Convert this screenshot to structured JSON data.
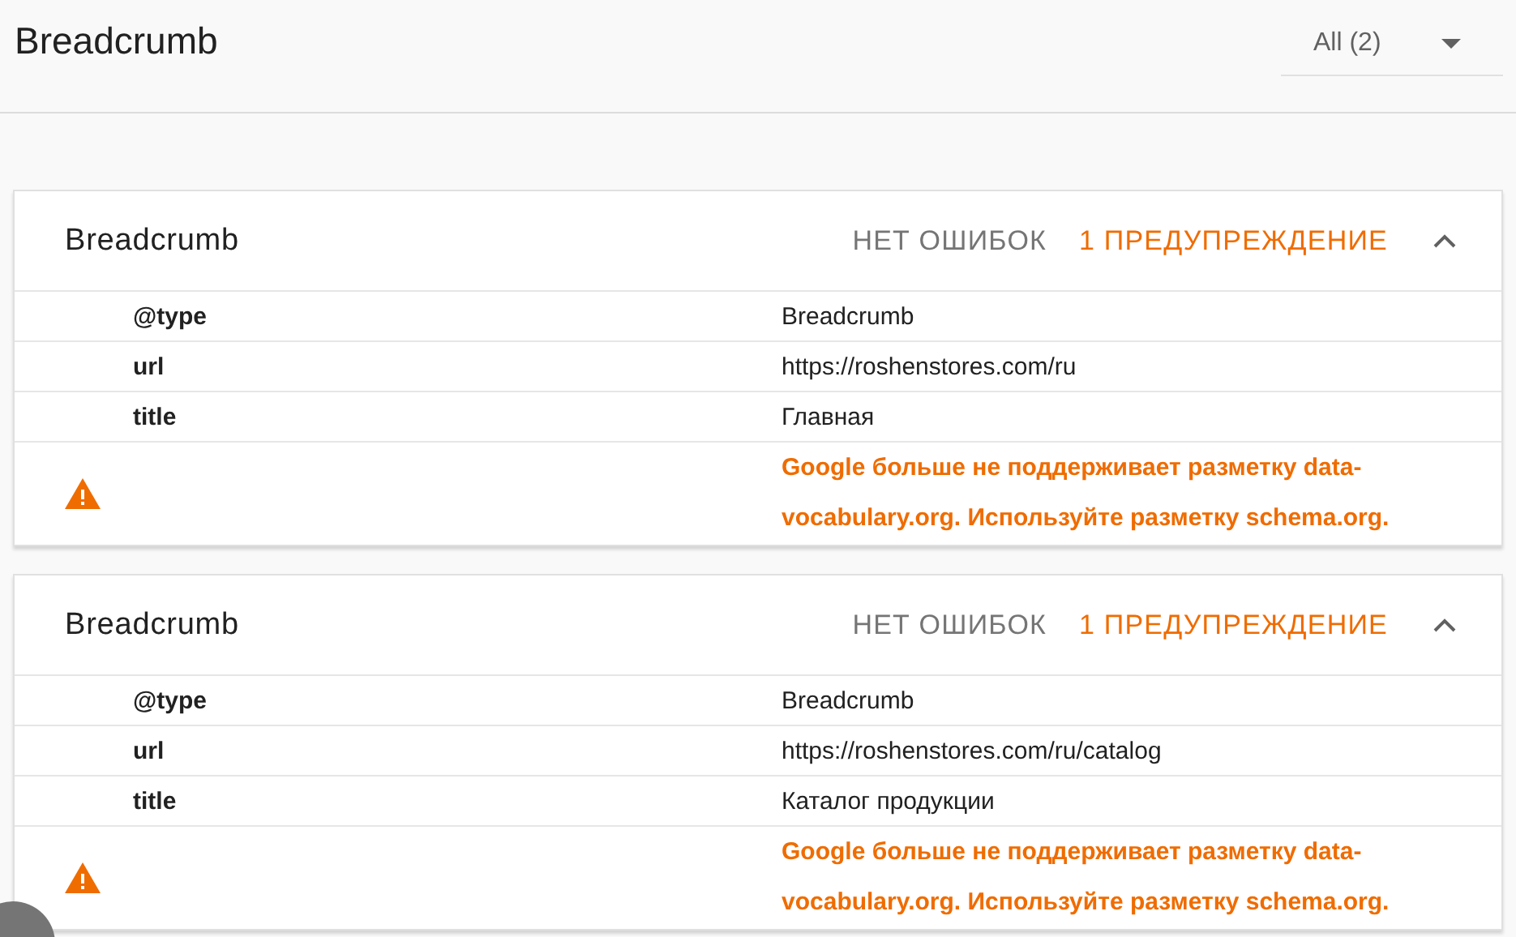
{
  "title": "Breadcrumb",
  "filter": {
    "label": "All (2)"
  },
  "cards": [
    {
      "title": "Breadcrumb",
      "errors": "НЕТ ОШИБОК",
      "warnings": "1 ПРЕДУПРЕЖДЕНИЕ",
      "expanded": true,
      "properties": [
        {
          "name": "@type",
          "value": "Breadcrumb"
        },
        {
          "name": "url",
          "value": "https://roshenstores.com/ru"
        },
        {
          "name": "title",
          "value": "Главная"
        }
      ],
      "messages": [
        {
          "text": "Google больше не поддерживает разметку data-vocabulary.org. Используйте разметку schema.org."
        }
      ]
    },
    {
      "title": "Breadcrumb",
      "errors": "НЕТ ОШИБОК",
      "warnings": "1 ПРЕДУПРЕЖДЕНИЕ",
      "expanded": true,
      "properties": [
        {
          "name": "@type",
          "value": "Breadcrumb"
        },
        {
          "name": "url",
          "value": "https://roshenstores.com/ru/catalog"
        },
        {
          "name": "title",
          "value": "Каталог продукции"
        }
      ],
      "messages": [
        {
          "text": "Google больше не поддерживает разметку data-vocabulary.org. Используйте разметку schema.org."
        }
      ]
    }
  ]
}
